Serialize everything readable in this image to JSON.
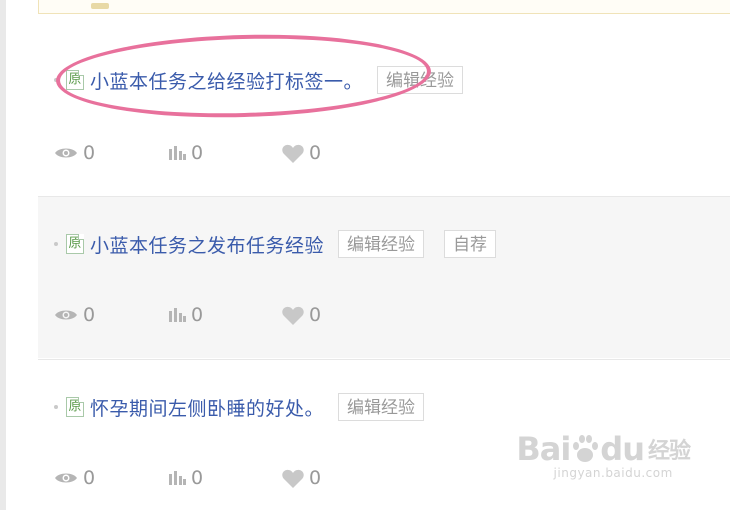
{
  "items": [
    {
      "badge": "原",
      "title": "小蓝本任务之给经验打标签一。",
      "tags": [
        "编辑经验"
      ],
      "views": "0",
      "votes": "0",
      "likes": "0"
    },
    {
      "badge": "原",
      "title": "小蓝本任务之发布任务经验",
      "tags": [
        "编辑经验",
        "自荐"
      ],
      "views": "0",
      "votes": "0",
      "likes": "0"
    },
    {
      "badge": "原",
      "title": "怀孕期间左侧卧睡的好处。",
      "tags": [
        "编辑经验"
      ],
      "views": "0",
      "votes": "0",
      "likes": "0"
    }
  ],
  "watermark": {
    "brand_left": "Bai",
    "brand_right": "du",
    "brand_cn": "经验",
    "url": "jingyan.baidu.com"
  },
  "colors": {
    "link": "#3a5bab",
    "highlight": "#e8719c",
    "alt_row": "#f6f6f6"
  }
}
